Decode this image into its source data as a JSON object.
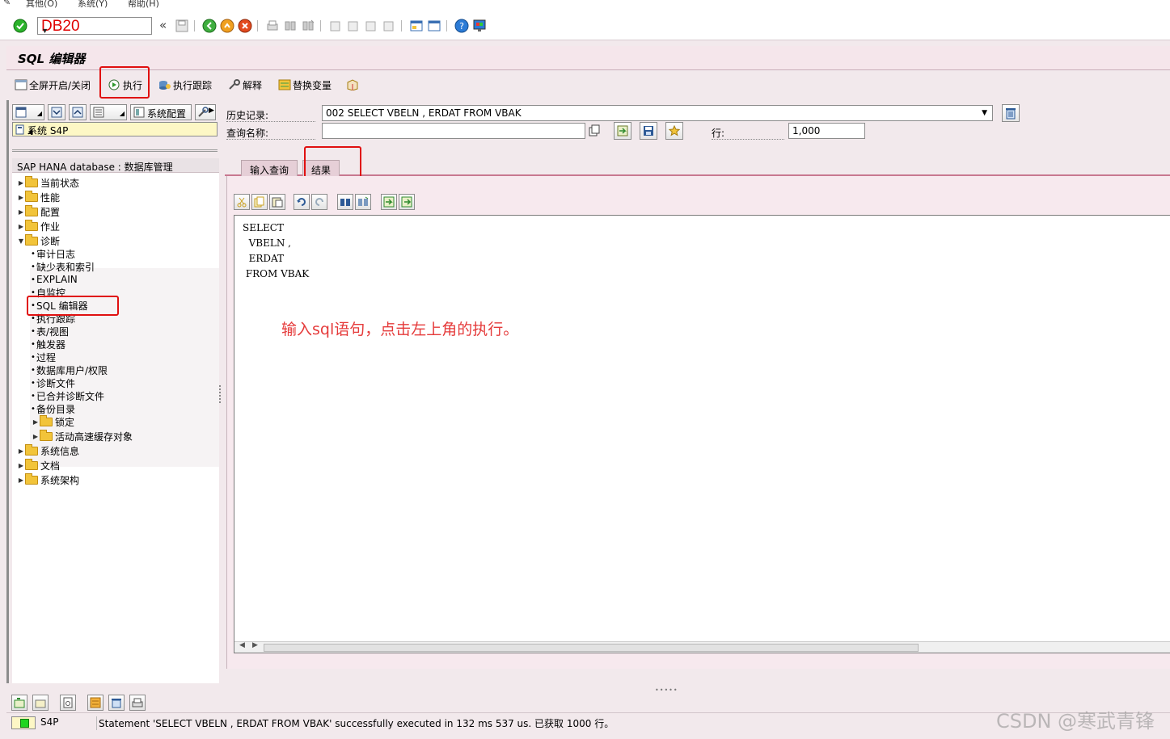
{
  "menubar": {
    "items": [
      "其他(O)",
      "系统(Y)",
      "帮助(H)"
    ]
  },
  "toolbar": {
    "command_value": "DB20",
    "back_label": "«"
  },
  "title": "SQL 编辑器",
  "app_toolbar": {
    "fullscreen_label": "全屏开启/关闭",
    "execute_label": "执行",
    "exec_trace_label": "执行跟踪",
    "explain_label": "解释",
    "replace_vars_label": "替换变量"
  },
  "left": {
    "config_button": "系统配置",
    "system_value": "系统 S4P",
    "tree_header": "SAP HANA database : 数据库管理",
    "tree": [
      {
        "label": "当前状态",
        "type": "folder",
        "level": 0,
        "expanded": false
      },
      {
        "label": "性能",
        "type": "folder",
        "level": 0,
        "expanded": false
      },
      {
        "label": "配置",
        "type": "folder",
        "level": 0,
        "expanded": false
      },
      {
        "label": "作业",
        "type": "folder",
        "level": 0,
        "expanded": false
      },
      {
        "label": "诊断",
        "type": "folder",
        "level": 0,
        "expanded": true
      },
      {
        "label": "审计日志",
        "type": "leaf",
        "level": 1
      },
      {
        "label": "缺少表和索引",
        "type": "leaf",
        "level": 1
      },
      {
        "label": "EXPLAIN",
        "type": "leaf",
        "level": 1
      },
      {
        "label": "自监控",
        "type": "leaf",
        "level": 1
      },
      {
        "label": "SQL 编辑器",
        "type": "leaf",
        "level": 1
      },
      {
        "label": "执行跟踪",
        "type": "leaf",
        "level": 1
      },
      {
        "label": "表/视图",
        "type": "leaf",
        "level": 1
      },
      {
        "label": "触发器",
        "type": "leaf",
        "level": 1
      },
      {
        "label": "过程",
        "type": "leaf",
        "level": 1
      },
      {
        "label": "数据库用户/权限",
        "type": "leaf",
        "level": 1
      },
      {
        "label": "诊断文件",
        "type": "leaf",
        "level": 1
      },
      {
        "label": "已合并诊断文件",
        "type": "leaf",
        "level": 1
      },
      {
        "label": "备份目录",
        "type": "leaf",
        "level": 1
      },
      {
        "label": "锁定",
        "type": "folder",
        "level": 1,
        "expanded": false
      },
      {
        "label": "活动高速缓存对象",
        "type": "folder",
        "level": 1,
        "expanded": false
      },
      {
        "label": "系统信息",
        "type": "folder",
        "level": 0,
        "expanded": false
      },
      {
        "label": "文档",
        "type": "folder",
        "level": 0,
        "expanded": false
      },
      {
        "label": "系统架构",
        "type": "folder",
        "level": 0,
        "expanded": false
      }
    ]
  },
  "form": {
    "history_label": "历史记录:",
    "history_value": "002 SELECT VBELN , ERDAT FROM VBAK",
    "query_name_label": "查询名称:",
    "query_name_value": "",
    "rows_label": "行:",
    "rows_value": "1,000"
  },
  "tabs": [
    "输入查询",
    "结果"
  ],
  "editor": {
    "code": "SELECT\n  VBELN ,\n  ERDAT\n FROM VBAK",
    "annotation": "输入sql语句，点击左上角的执行。"
  },
  "status": {
    "system": "S4P",
    "message": "Statement 'SELECT VBELN , ERDAT FROM VBAK' successfully executed in 132 ms 537 us. 已获取 1000 行。"
  },
  "watermark": "CSDN @寒武青锋",
  "colors": {
    "highlight_red": "#e01010",
    "annotation_red": "#e53a3a",
    "status_green": "#1fd51f",
    "command_red": "#e00000"
  }
}
